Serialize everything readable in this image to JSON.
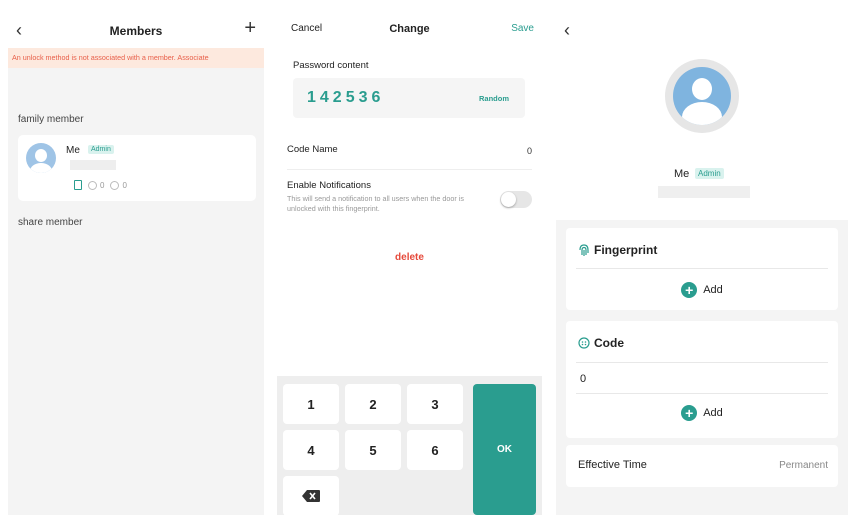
{
  "members_screen": {
    "title": "Members",
    "back_icon": "‹",
    "add_icon": "+",
    "warning": "An unlock method is not associated with a member. Associate",
    "family_section": "family member",
    "share_section": "share member",
    "member": {
      "name": "Me",
      "role": "Admin",
      "count_a": "0",
      "count_b": "0"
    }
  },
  "change_screen": {
    "cancel": "Cancel",
    "title": "Change",
    "save": "Save",
    "password_label": "Password content",
    "password_value": "142536",
    "random": "Random",
    "code_name_label": "Code Name",
    "code_name_value": "0",
    "notif_title": "Enable Notifications",
    "notif_desc": "This will send a notification to all users when the door is unlocked with this fingerprint.",
    "notif_enabled": false,
    "delete": "delete",
    "keypad": {
      "k1": "1",
      "k2": "2",
      "k3": "3",
      "k4": "4",
      "k5": "5",
      "k6": "6",
      "ok": "OK"
    }
  },
  "detail_screen": {
    "back_icon": "‹",
    "name": "Me",
    "role": "Admin",
    "fingerprint_title": "Fingerprint",
    "fingerprint_add": "Add",
    "code_title": "Code",
    "code_value": "0",
    "code_add": "Add",
    "effective_label": "Effective Time",
    "effective_value": "Permanent"
  },
  "colors": {
    "accent": "#2a9d8f",
    "danger": "#e64a3b",
    "warning_bg": "#fde9de",
    "warning_text": "#e8604a"
  }
}
